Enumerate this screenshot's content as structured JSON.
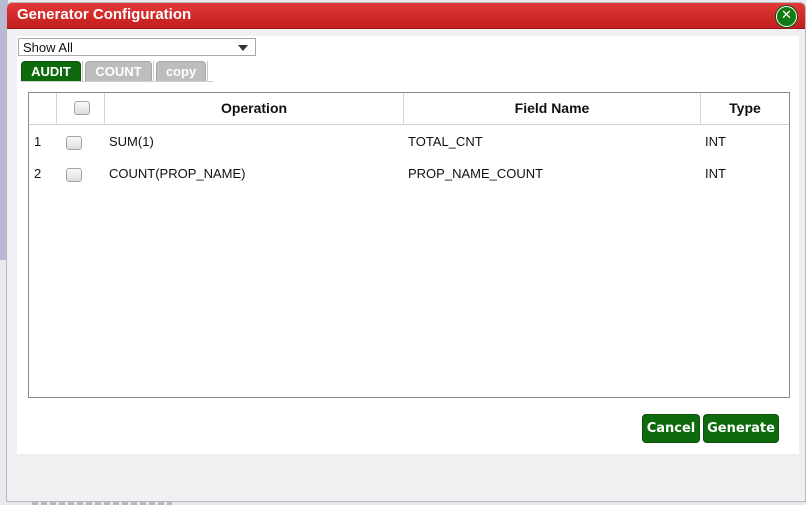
{
  "dialog": {
    "title": "Generator Configuration",
    "close_icon": "close-icon"
  },
  "filter": {
    "selected": "Show All"
  },
  "tabs": [
    {
      "label": "AUDIT",
      "active": true
    },
    {
      "label": "COUNT",
      "active": false
    },
    {
      "label": "copy",
      "active": false
    }
  ],
  "table": {
    "columns": [
      "Operation",
      "Field Name",
      "Type"
    ],
    "rows": [
      {
        "num": "1",
        "operation": "SUM(1)",
        "field_name": "TOTAL_CNT",
        "type": "INT"
      },
      {
        "num": "2",
        "operation": "COUNT(PROP_NAME)",
        "field_name": "PROP_NAME_COUNT",
        "type": "INT"
      }
    ]
  },
  "buttons": {
    "cancel": "Cancel",
    "generate": "Generate"
  },
  "colors": {
    "title_bar": "#d62b2b",
    "accent_green": "#0d6a0d",
    "inactive_tab": "#bdbdbd"
  }
}
